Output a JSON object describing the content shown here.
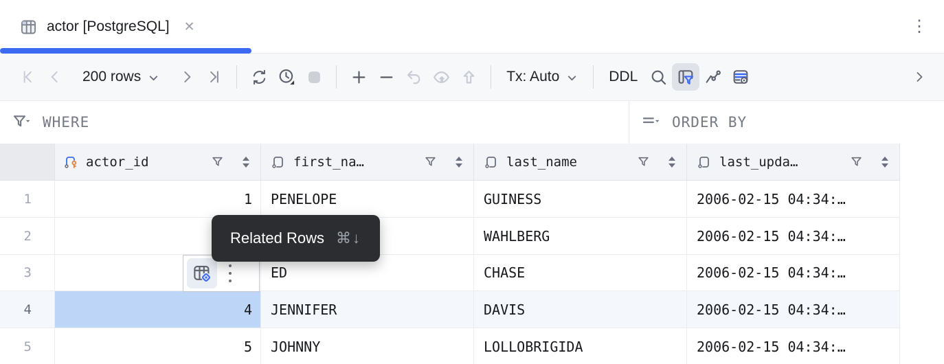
{
  "tab": {
    "title": "actor [PostgreSQL]",
    "close_glyph": "✕"
  },
  "window": {
    "kebab_glyph": "⋮"
  },
  "toolbar": {
    "rows_label": "200 rows",
    "tx_label": "Tx: Auto",
    "ddl_label": "DDL"
  },
  "filterbar": {
    "where_label": "WHERE",
    "order_by_label": "ORDER BY"
  },
  "tooltip": {
    "label": "Related Rows",
    "shortcut": "⌘↓"
  },
  "grid": {
    "columns": {
      "0": "actor_id",
      "1": "first_na…",
      "2": "last_name",
      "3": "last_upda…"
    },
    "rows": {
      "0": {
        "num": "1",
        "actor_id": "1",
        "first_name": "PENELOPE",
        "last_name": "GUINESS",
        "last_update": "2006-02-15 04:34:…"
      },
      "1": {
        "num": "2",
        "actor_id": "",
        "first_name": "",
        "last_name": "WAHLBERG",
        "last_update": "2006-02-15 04:34:…"
      },
      "2": {
        "num": "3",
        "actor_id": "",
        "first_name": "ED",
        "last_name": "CHASE",
        "last_update": "2006-02-15 04:34:…"
      },
      "3": {
        "num": "4",
        "actor_id": "4",
        "first_name": "JENNIFER",
        "last_name": "DAVIS",
        "last_update": "2006-02-15 04:34:…"
      },
      "4": {
        "num": "5",
        "actor_id": "5",
        "first_name": "JOHNNY",
        "last_name": "LOLLOBRIGIDA",
        "last_update": "2006-02-15 04:34:…"
      }
    }
  },
  "colors": {
    "accent_blue": "#3d6af2",
    "selection_blue": "#bdd5f6",
    "tooltip_bg": "#2b2d30",
    "key_orange": "#e2833f",
    "toolbar_bg": "#f7f8fa",
    "header_bg": "#f3f4f7"
  }
}
